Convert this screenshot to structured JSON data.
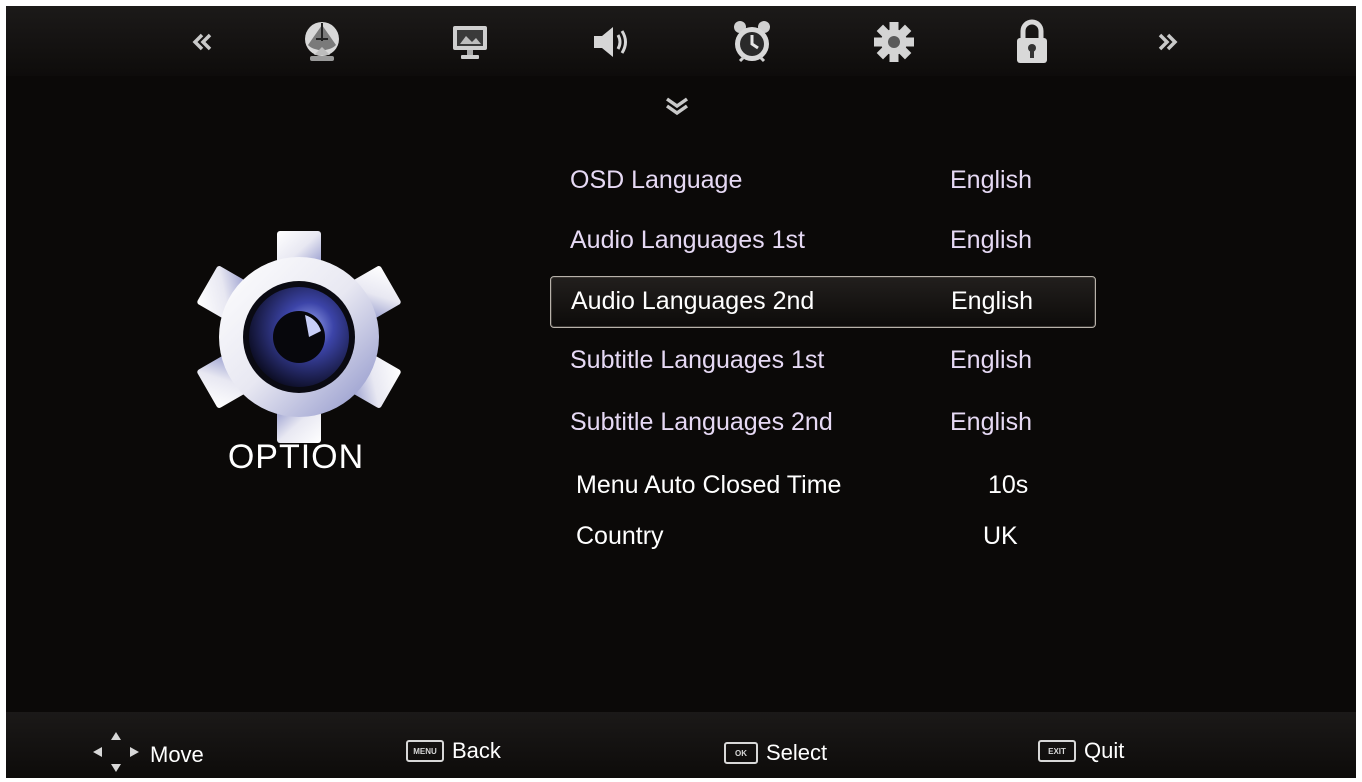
{
  "nav": {
    "items": [
      {
        "name": "prev-arrow",
        "icon": "double-chevron-left-icon"
      },
      {
        "name": "channel",
        "icon": "satellite-dish-icon"
      },
      {
        "name": "picture",
        "icon": "monitor-icon"
      },
      {
        "name": "sound",
        "icon": "speaker-icon"
      },
      {
        "name": "time",
        "icon": "alarm-clock-icon"
      },
      {
        "name": "option",
        "icon": "gear-icon",
        "active": true
      },
      {
        "name": "lock",
        "icon": "padlock-icon"
      },
      {
        "name": "next-arrow",
        "icon": "double-chevron-right-icon"
      }
    ]
  },
  "section": {
    "title": "OPTION",
    "icon": "gear-icon"
  },
  "menu": {
    "items": [
      {
        "label": "OSD Language",
        "value": "English"
      },
      {
        "label": "Audio Languages  1st",
        "value": "English"
      },
      {
        "label": "Audio Languages  2nd",
        "value": "English",
        "selected": true
      },
      {
        "label": "Subtitle Languages  1st",
        "value": "English"
      },
      {
        "label": "Subtitle Languages  2nd",
        "value": "English"
      },
      {
        "label": "Menu Auto Closed Time",
        "value": "10s"
      },
      {
        "label": "Country",
        "value": "UK"
      }
    ]
  },
  "help": {
    "move": {
      "label": "Move",
      "icon": "dpad-arrows-icon"
    },
    "back": {
      "label": "Back",
      "key": "MENU"
    },
    "select": {
      "label": "Select",
      "key": "OK"
    },
    "quit": {
      "label": "Quit",
      "key": "EXIT"
    }
  },
  "colors": {
    "background": "#0b0908",
    "menu_text": "#e6d9f4",
    "accent_blue": "#5b6ad8"
  }
}
